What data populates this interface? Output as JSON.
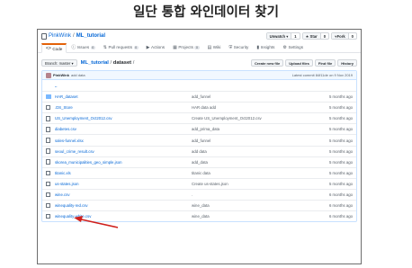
{
  "caption": "일단 통합 와인데이터 찾기",
  "repo": {
    "owner": "PinkWink",
    "separator": "/",
    "name": "ML_tutorial",
    "unwatch_label": "Unwatch ▾",
    "unwatch_count": "1",
    "star_label": "★ Star",
    "star_count": "0",
    "fork_label": "Fork",
    "fork_count": "0"
  },
  "tabs": [
    {
      "icon": "<>",
      "label": "Code",
      "badge": ""
    },
    {
      "icon": "ⓘ",
      "label": "Issues",
      "badge": "0"
    },
    {
      "icon": "⇅",
      "label": "Pull requests",
      "badge": "0"
    },
    {
      "icon": "▶",
      "label": "Actions",
      "badge": ""
    },
    {
      "icon": "▦",
      "label": "Projects",
      "badge": "0"
    },
    {
      "icon": "▤",
      "label": "Wiki",
      "badge": ""
    },
    {
      "icon": "⛨",
      "label": "Security",
      "badge": ""
    },
    {
      "icon": "▮",
      "label": "Insights",
      "badge": ""
    },
    {
      "icon": "⚙",
      "label": "Settings",
      "badge": ""
    }
  ],
  "file_nav": {
    "branch_label": "Branch: master ▾",
    "path_repo": "ML_tutorial",
    "path_sep": "/",
    "path_dir": "dataset",
    "path_tail": "/",
    "buttons": [
      "Create new file",
      "Upload files",
      "Find file",
      "History"
    ]
  },
  "commit": {
    "author": "PinkWink",
    "message": "add data",
    "latest": "Latest commit 84f11de on 9 Nov 2019"
  },
  "parent_dir": "..",
  "files": [
    {
      "type": "dir",
      "name": "HAR_dataset",
      "message": "add_funnel",
      "age": "5 months ago"
    },
    {
      "type": "file",
      "name": ".DS_Store",
      "message": "HAR data add",
      "age": "5 months ago"
    },
    {
      "type": "file",
      "name": "US_Unemployment_Oct2012.csv",
      "message": "Create US_Unemployment_Oct2012.csv",
      "age": "5 months ago"
    },
    {
      "type": "file",
      "name": "diabetes.csv",
      "message": "add_prima_data",
      "age": "5 months ago"
    },
    {
      "type": "file",
      "name": "sales-funnel.xlsx",
      "message": "add_funnel",
      "age": "5 months ago"
    },
    {
      "type": "file",
      "name": "seoul_crime_result.csv",
      "message": "add data",
      "age": "5 months ago"
    },
    {
      "type": "file",
      "name": "skorea_municipalities_geo_simple.json",
      "message": "add_data",
      "age": "5 months ago"
    },
    {
      "type": "file",
      "name": "titanic.xls",
      "message": "titanic data",
      "age": "5 months ago"
    },
    {
      "type": "file",
      "name": "us-states.json",
      "message": "Create us-states.json",
      "age": "5 months ago"
    },
    {
      "type": "file",
      "name": "wine.csv",
      "message": ".",
      "age": "6 months ago"
    },
    {
      "type": "file",
      "name": "winequality-red.csv",
      "message": "wine_data",
      "age": "6 months ago"
    },
    {
      "type": "file",
      "name": "winequality-white.csv",
      "message": "wine_data",
      "age": "6 months ago"
    }
  ],
  "colors": {
    "link": "#0366d6",
    "annotation_arrow": "#d0201c",
    "commit_bar": "#f1f8ff"
  }
}
